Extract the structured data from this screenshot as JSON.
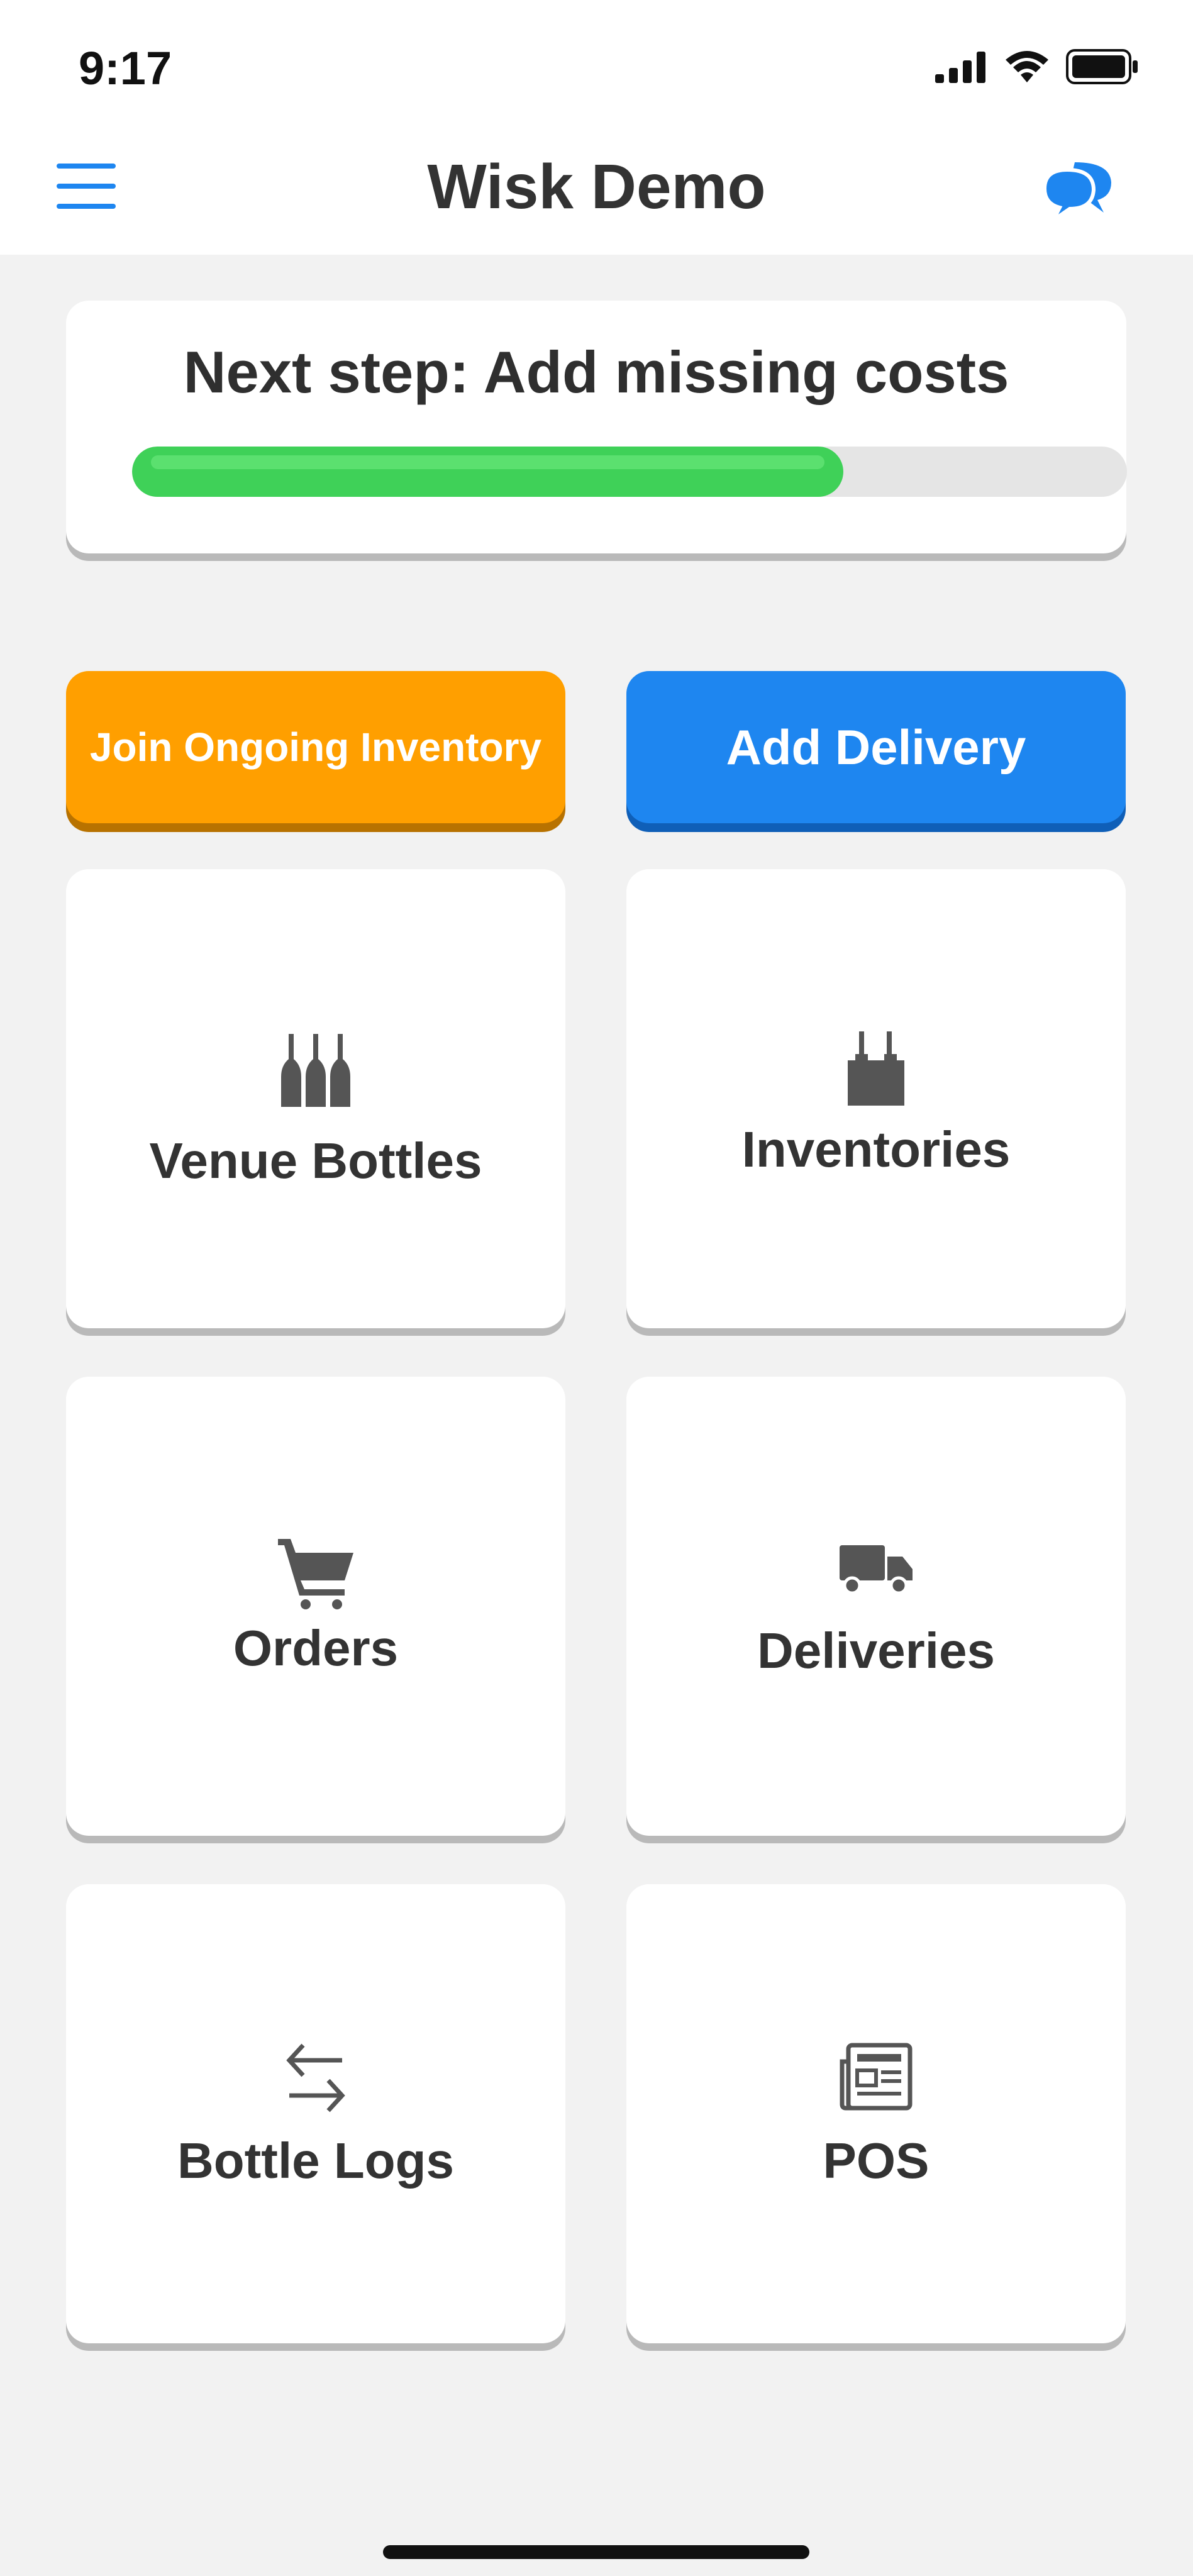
{
  "status_bar": {
    "time": "9:17",
    "icons": [
      "signal-icon",
      "wifi-icon",
      "battery-icon"
    ]
  },
  "nav": {
    "title": "Wisk Demo",
    "menu_icon": "hamburger-menu-icon",
    "chat_icon": "chat-bubbles-icon",
    "accent_color": "#1e86f0"
  },
  "next_step": {
    "text": "Next step: Add missing costs",
    "progress_fraction": 0.715,
    "progress_color": "#3fd158"
  },
  "actions": {
    "join_label": "Join Ongoing Inventory",
    "join_color": "#ff9f00",
    "delivery_label": "Add Delivery",
    "delivery_color": "#1e86f0"
  },
  "tiles": [
    {
      "label": "Venue Bottles",
      "icon": "bottles-icon"
    },
    {
      "label": "Inventories",
      "icon": "inventory-box-icon"
    },
    {
      "label": "Orders",
      "icon": "shopping-cart-icon"
    },
    {
      "label": "Deliveries",
      "icon": "delivery-truck-icon"
    },
    {
      "label": "Bottle Logs",
      "icon": "arrows-exchange-icon"
    },
    {
      "label": "POS",
      "icon": "receipt-document-icon"
    }
  ]
}
